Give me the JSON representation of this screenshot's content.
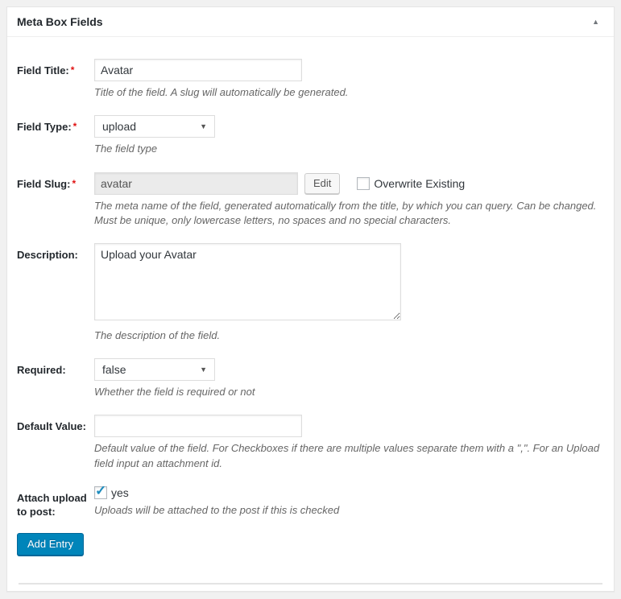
{
  "panel": {
    "title": "Meta Box Fields"
  },
  "icons": {
    "collapse": "▲",
    "dropdown": "▼",
    "checkmark": "✓"
  },
  "fields": {
    "field_title": {
      "label": "Field Title:",
      "required_mark": "*",
      "value": "Avatar",
      "help": "Title of the field. A slug will automatically be generated."
    },
    "field_type": {
      "label": "Field Type:",
      "required_mark": "*",
      "value": "upload",
      "help": "The field type"
    },
    "field_slug": {
      "label": "Field Slug:",
      "required_mark": "*",
      "value": "avatar",
      "edit_button": "Edit",
      "overwrite_label": "Overwrite Existing",
      "help": "The meta name of the field, generated automatically from the title, by which you can query. Can be changed. Must be unique, only lowercase letters, no spaces and no special characters."
    },
    "description": {
      "label": "Description:",
      "value": "Upload your Avatar",
      "help": "The description of the field."
    },
    "required": {
      "label": "Required:",
      "value": "false",
      "help": "Whether the field is required or not"
    },
    "default_value": {
      "label": "Default Value:",
      "value": "",
      "help": "Default value of the field. For Checkboxes if there are multiple values separate them with a \",\". For an Upload field input an attachment id."
    },
    "attach_upload": {
      "label": "Attach upload to post:",
      "checkbox_label": "yes",
      "help": "Uploads will be attached to the post if this is checked"
    }
  },
  "actions": {
    "add_entry": "Add Entry"
  },
  "colors": {
    "primary_button": "#0085ba",
    "primary_button_border": "#006799",
    "required_asterisk": "#e01111",
    "checkmark_blue": "#1e8cbe",
    "page_background": "#f1f1f1",
    "box_border": "#e5e5e5"
  }
}
